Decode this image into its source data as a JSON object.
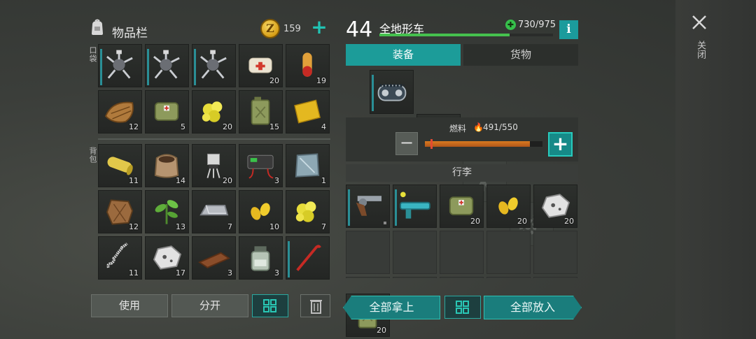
{
  "inventory": {
    "title": "物品栏",
    "coins": "159",
    "coin_symbol": "Z",
    "pocket_label": "口袋",
    "backpack_label": "背包",
    "pocket_items": [
      {
        "icon": "scorpion-turret-icon",
        "count": ""
      },
      {
        "icon": "scorpion-turret-icon",
        "count": ""
      },
      {
        "icon": "scorpion-turret-icon",
        "count": ""
      },
      {
        "icon": "bandage-icon",
        "count": "20"
      },
      {
        "icon": "pill-capsule-icon",
        "count": "19"
      },
      {
        "icon": "snake-skin-icon",
        "count": "12"
      },
      {
        "icon": "medkit-bag-icon",
        "count": "5"
      },
      {
        "icon": "sulfur-nugget-icon",
        "count": "20"
      },
      {
        "icon": "fuel-canister-icon",
        "count": "15"
      },
      {
        "icon": "gold-cloth-icon",
        "count": "4"
      }
    ],
    "backpack_items": [
      {
        "icon": "fabric-roll-icon",
        "count": "11"
      },
      {
        "icon": "soil-sack-icon",
        "count": "14"
      },
      {
        "icon": "transistor-icon",
        "count": "20"
      },
      {
        "icon": "battery-icon",
        "count": "3"
      },
      {
        "icon": "steel-plate-icon",
        "count": "1"
      },
      {
        "icon": "animal-hide-icon",
        "count": "12"
      },
      {
        "icon": "plant-sprout-icon",
        "count": "13"
      },
      {
        "icon": "metal-ingot-icon",
        "count": "7"
      },
      {
        "icon": "corn-seeds-icon",
        "count": "10"
      },
      {
        "icon": "sulfur-nugget-icon",
        "count": "7"
      },
      {
        "icon": "spring-icon",
        "count": "11"
      },
      {
        "icon": "ore-stone-icon",
        "count": "17"
      },
      {
        "icon": "wood-plank-icon",
        "count": "3"
      },
      {
        "icon": "chemical-jar-icon",
        "count": "3"
      },
      {
        "icon": "crowbar-icon",
        "count": ""
      }
    ],
    "buttons": {
      "use": "使用",
      "split": "分开"
    }
  },
  "vehicle": {
    "level": "44",
    "name": "全地形车",
    "hp": "730/975",
    "hp_fraction": 0.749,
    "info": "i",
    "tabs": [
      "装备",
      "货物"
    ],
    "fuel_label": "燃料",
    "fuel_value": "491/550",
    "fuel_fraction": 0.89,
    "fuel_item_count": "20",
    "trunk_label": "行李",
    "trunk_items": [
      {
        "icon": "revolver-icon",
        "count": ""
      },
      {
        "icon": "laser-rifle-icon",
        "count": ""
      },
      {
        "icon": "medkit-bag-icon",
        "count": "20"
      },
      {
        "icon": "corn-seeds-icon",
        "count": "20"
      },
      {
        "icon": "ore-stone-icon",
        "count": "20"
      }
    ],
    "buttons": {
      "take_all": "全部拿上",
      "put_all": "全部放入"
    }
  },
  "close_label": "关闭",
  "colors": {
    "accent": "#1c9c99",
    "hp": "#45c14e",
    "fuel": "#d97a20"
  }
}
